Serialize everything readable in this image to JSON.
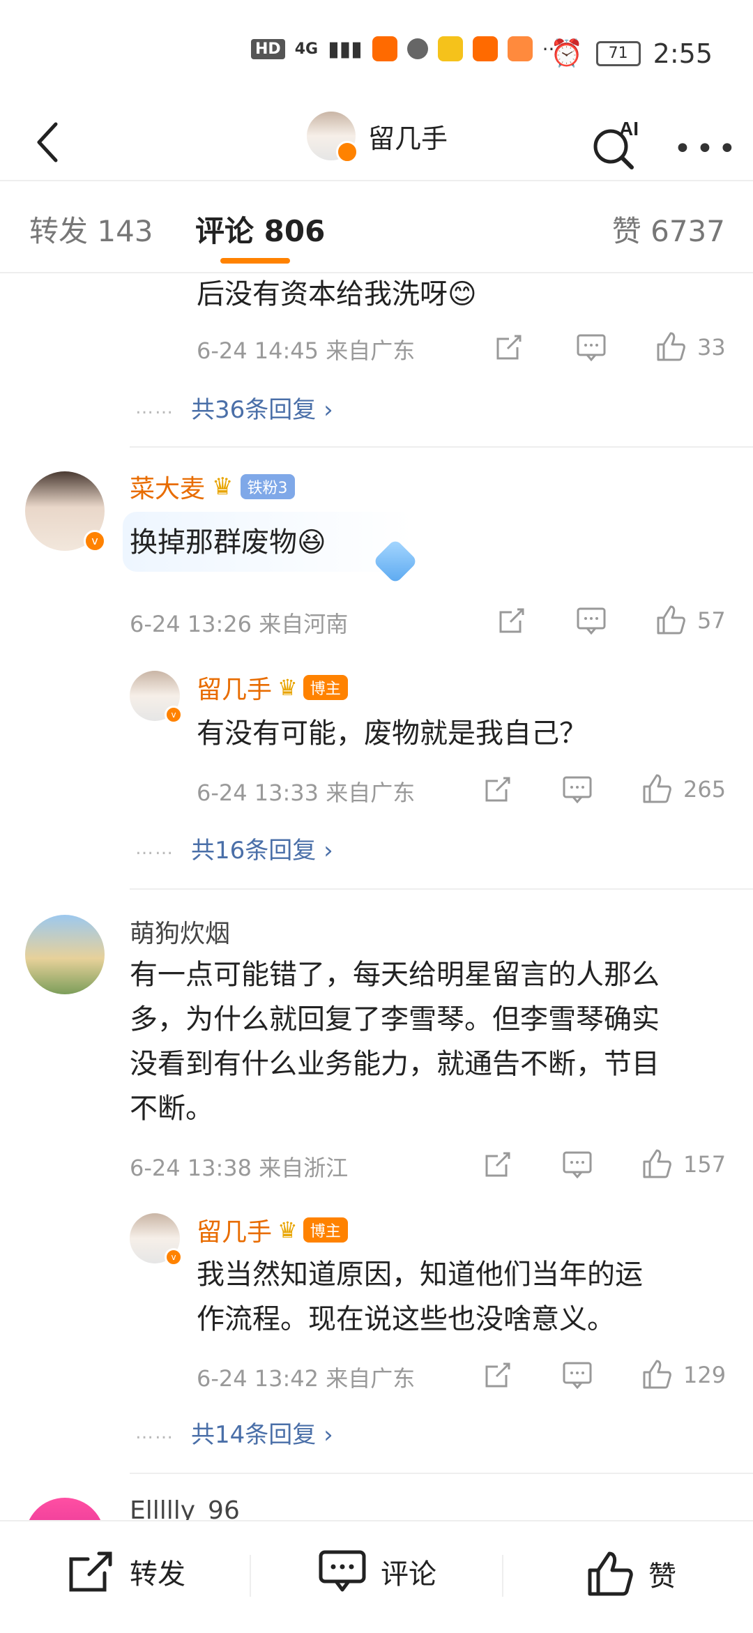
{
  "status_bar": {
    "left_badges": [
      "HD",
      "4G"
    ],
    "more": "···",
    "battery": "71",
    "time": "2:55"
  },
  "header": {
    "title": "留几手",
    "ai_label": "AI",
    "more": "•••"
  },
  "tabs": [
    {
      "label": "转发 143"
    },
    {
      "label": "评论 806"
    },
    {
      "label": "赞 6737"
    }
  ],
  "comments": [
    {
      "text": "后没有资本给我洗呀😊",
      "meta": "6-24 14:45 来自广东",
      "likes": "33",
      "more_replies": "共36条回复 ›"
    },
    {
      "name": "菜大麦",
      "tag": "铁粉3",
      "text": "换掉那群废物😆",
      "meta": "6-24 13:26 来自河南",
      "likes": "57",
      "reply": {
        "name": "留几手",
        "tag": "博主",
        "text": "有没有可能，废物就是我自己？",
        "meta": "6-24 13:33 来自广东",
        "likes": "265"
      },
      "more_replies": "共16条回复 ›"
    },
    {
      "name": "萌狗炊烟",
      "text": "有一点可能错了，每天给明星留言的人那么多，为什么就回复了李雪琴。但李雪琴确实没看到有什么业务能力，就通告不断，节目不断。",
      "lines": [
        "有一点可能错了，每天给明星留言的人那么",
        "多，为什么就回复了李雪琴。但李雪琴确实",
        "没看到有什么业务能力，就通告不断，节目",
        "不断。"
      ],
      "meta": "6-24 13:38 来自浙江",
      "likes": "157",
      "reply": {
        "name": "留几手",
        "tag": "博主",
        "lines": [
          "我当然知道原因，知道他们当年的运",
          "作流程。现在说这些也没啥意义。"
        ],
        "meta": "6-24 13:42 来自广东",
        "likes": "129"
      },
      "more_replies": "共14条回复 ›"
    },
    {
      "name": "Ellllly_96"
    }
  ],
  "bottom_bar": {
    "repost": "转发",
    "comment": "评论",
    "like": "赞"
  },
  "colors": {
    "accent": "#ff8200",
    "name": "#e86c00",
    "link": "#4a6fa8",
    "meta": "#999999"
  }
}
